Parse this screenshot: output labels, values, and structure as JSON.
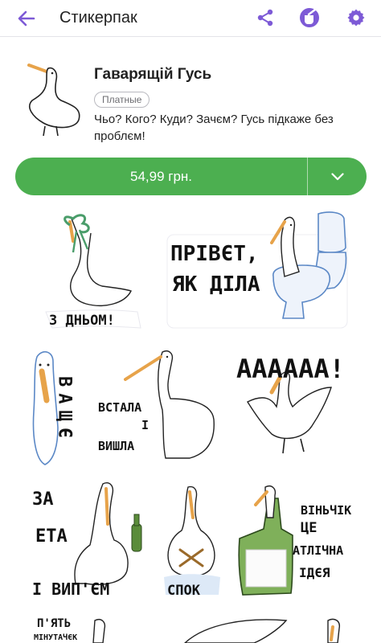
{
  "appbar": {
    "title": "Стикерпак",
    "icons": [
      "back-arrow-icon",
      "share-icon",
      "paint-cup-icon",
      "gear-icon"
    ],
    "accent": "#7d5ad6"
  },
  "pack": {
    "name": "Гаварящій Гусь",
    "badge": "Платные",
    "description": "Чьо? Кого? Куди? Зачєм? Гусь підкаже без проблєм!"
  },
  "buy": {
    "price": "54,99 грн.",
    "color": "#4caf50"
  },
  "stickers": [
    {
      "caption": "З ДНЬОМ!"
    },
    {
      "caption_line1": "ПРІВЄТ,",
      "caption_line2": "ЯК ДІЛА"
    },
    {
      "caption": "ВАЩЄ"
    },
    {
      "caption_line1": "ВСТАЛА",
      "caption_mid": "І",
      "caption_line2": "ВИШЛА"
    },
    {
      "caption": "АААААА!"
    },
    {
      "caption_line1": "ЗА",
      "caption_line2": "ЕТА",
      "caption_line3": "І ВИП'ЄМ"
    },
    {
      "caption": "СПОК"
    },
    {
      "caption_line1": "ВІНЬЧІК",
      "caption_line2": "ЦЕ",
      "caption_line3": "АТЛІЧНА",
      "caption_line4": "ІДЄЯ"
    },
    {
      "caption_line1": "П'ЯТЬ",
      "caption_line2": "МІНУТАЧЄК"
    }
  ]
}
